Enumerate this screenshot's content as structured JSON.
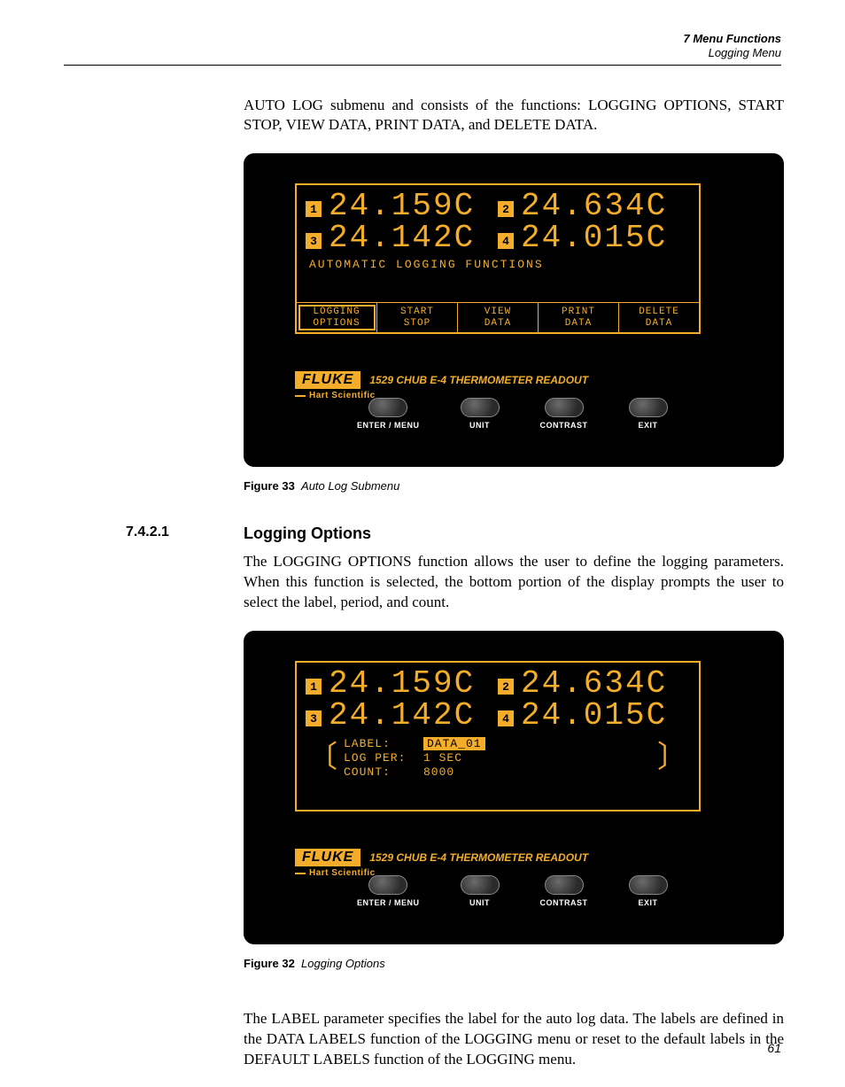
{
  "header": {
    "chapter": "7  Menu Functions",
    "section": "Logging Menu"
  },
  "intro": "AUTO LOG submenu and consists of the functions: LOGGING OPTIONS, START STOP, VIEW DATA, PRINT DATA, and DELETE DATA.",
  "figure33": {
    "label": "Figure 33",
    "title": "Auto Log Submenu"
  },
  "section": {
    "num": "7.4.2.1",
    "title": "Logging Options"
  },
  "para1": "The LOGGING OPTIONS function allows the user to define the logging parameters.  When this function is selected, the bottom portion of the display prompts the user to select the label, period, and count.",
  "figure32": {
    "label": "Figure 32",
    "title": "Logging Options"
  },
  "para2": "The LABEL parameter specifies the label for the auto log data. The labels are defined in the DATA LABELS function of the LOGGING menu or reset to the default labels in the DEFAULT LABELS function of the LOGGING menu.",
  "page_num": "61",
  "device": {
    "readouts": {
      "ch1": {
        "num": "1",
        "val": "24.159C"
      },
      "ch2": {
        "num": "2",
        "val": "24.634C"
      },
      "ch3": {
        "num": "3",
        "val": "24.142C"
      },
      "ch4": {
        "num": "4",
        "val": "24.015C"
      }
    },
    "subtitle": "AUTOMATIC LOGGING FUNCTIONS",
    "menu": {
      "m1a": "LOGGING",
      "m1b": "OPTIONS",
      "m2a": "START",
      "m2b": "STOP",
      "m3a": "VIEW",
      "m3b": "DATA",
      "m4a": "PRINT",
      "m4b": "DATA",
      "m5a": "DELETE",
      "m5b": "DATA"
    },
    "params": {
      "label_k": "LABEL:",
      "label_v": "DATA_01",
      "per_k": "LOG PER:",
      "per_v": "1 SEC",
      "cnt_k": "COUNT:",
      "cnt_v": "8000"
    },
    "brand": {
      "fluke": "FLUKE",
      "model_num": "1529",
      "model_name": "CHUB E-4 THERMOMETER READOUT",
      "hart": "Hart Scientific"
    },
    "buttons": {
      "b1": "ENTER / MENU",
      "b2": "UNIT",
      "b3": "CONTRAST",
      "b4": "EXIT"
    }
  }
}
